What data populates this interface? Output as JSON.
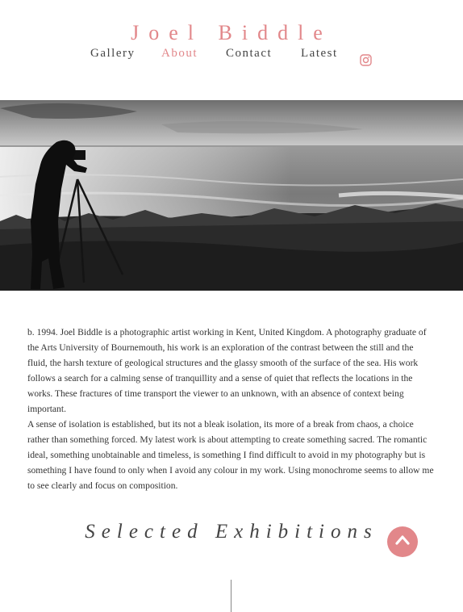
{
  "header": {
    "site_title": "Joel Biddle"
  },
  "nav": {
    "items": [
      {
        "label": "Gallery"
      },
      {
        "label": "About"
      },
      {
        "label": "Contact"
      },
      {
        "label": "Latest"
      }
    ],
    "instagram_icon": "instagram-icon",
    "active_color": "#e2878a"
  },
  "hero": {
    "photo": "black-and-white photograph of photographer with tripod on coastal cliff"
  },
  "bio": {
    "paragraph1": "b. 1994. Joel Biddle is a photographic artist working in Kent, United Kingdom. A photography graduate of the Arts University of Bournemouth, his work is an exploration of the contrast between the still and the fluid, the harsh texture of geological structures and the glassy smooth of the surface of the sea. His work follows a search for a calming sense of tranquillity and a sense of quiet that reflects the locations in the works. These fractures of time transport the viewer to an unknown, with an absence of context being important.",
    "paragraph2": "A sense of isolation is established, but its not a bleak isolation, its more of a break from chaos, a choice rather than something forced. My latest work is about attempting to create something sacred. The romantic ideal, something unobtainable and timeless, is something I find difficult to avoid in my photography but is something I have found to only when I avoid any colour in my work. Using monochrome seems to allow me to see clearly and focus on composition."
  },
  "exhibitions": {
    "title": "Selected Exhibitions"
  },
  "back_to_top": {
    "icon": "chevron-up-icon",
    "color": "#e2878a"
  }
}
